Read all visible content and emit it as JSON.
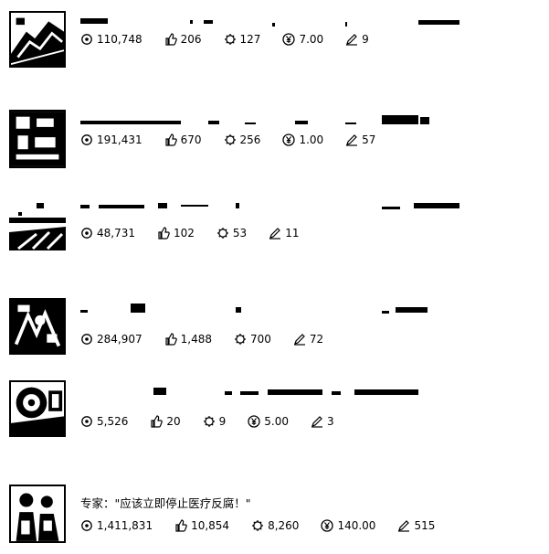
{
  "items": [
    {
      "title": "",
      "views": "110,748",
      "likes": "206",
      "shares": "127",
      "price": "7.00",
      "comments": "9"
    },
    {
      "title": "",
      "views": "191,431",
      "likes": "670",
      "shares": "256",
      "price": "1.00",
      "comments": "57"
    },
    {
      "title": "",
      "views": "48,731",
      "likes": "102",
      "shares": "53",
      "price": "",
      "comments": "11"
    },
    {
      "title": "",
      "views": "284,907",
      "likes": "1,488",
      "shares": "700",
      "price": "",
      "comments": "72"
    },
    {
      "title": "",
      "views": "5,526",
      "likes": "20",
      "shares": "9",
      "price": "5.00",
      "comments": "3"
    },
    {
      "title": "专家：\"应该立即停止医疗反腐！\"",
      "views": "1,411,831",
      "likes": "10,854",
      "shares": "8,260",
      "price": "140.00",
      "comments": "515"
    }
  ],
  "icons": {
    "views": "eye-icon",
    "likes": "thumbs-up-icon",
    "shares": "share-icon",
    "price": "yuan-icon",
    "comments": "pen-icon"
  }
}
